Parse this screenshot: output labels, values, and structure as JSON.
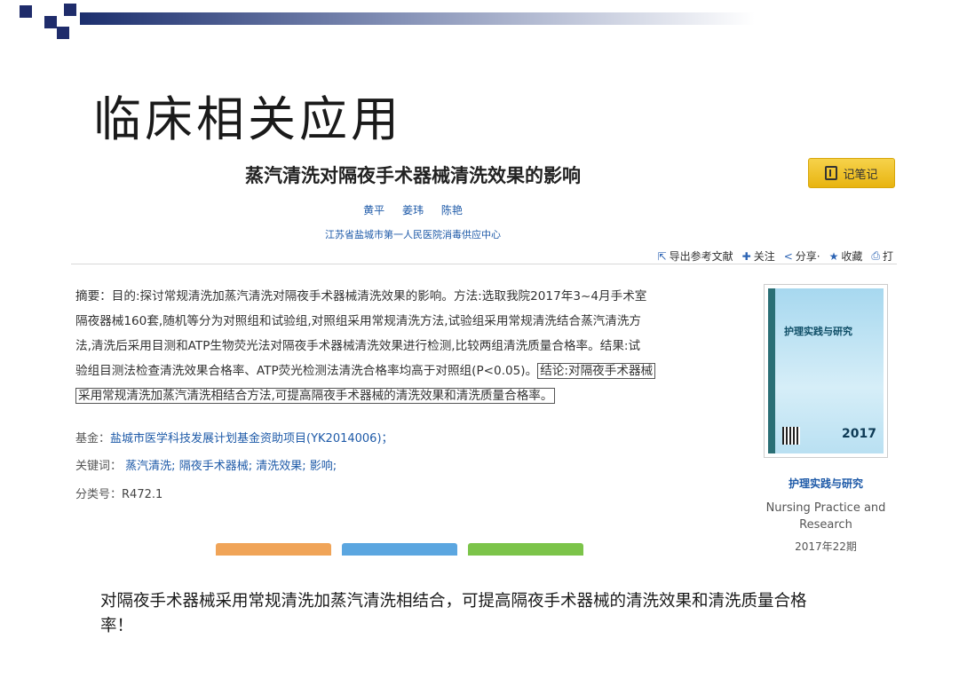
{
  "slide": {
    "title": "临床相关应用",
    "conclusion": "对隔夜手术器械采用常规清洗加蒸汽清洗相结合，可提高隔夜手术器械的清洗效果和清洗质量合格率！"
  },
  "article": {
    "title": "蒸汽清洗对隔夜手术器械清洗效果的影响",
    "note_button": "记笔记",
    "authors": [
      "黄平",
      "姜玮",
      "陈艳"
    ],
    "affiliation": "江苏省盐城市第一人民医院消毒供应中心",
    "tools": [
      {
        "icon": "export-icon",
        "label": "导出参考文献"
      },
      {
        "icon": "plus-icon",
        "label": "关注"
      },
      {
        "icon": "share-icon",
        "label": "分享·"
      },
      {
        "icon": "star-icon",
        "label": "收藏"
      },
      {
        "icon": "print-icon",
        "label": "打"
      }
    ],
    "abstract_lines": [
      "摘要：目的:探讨常规清洗加蒸汽清洗对隔夜手术器械清洗效果的影响。方法:选取我院2017年3~4月手术室",
      "隔夜器械160套,随机等分为对照组和试验组,对照组采用常规清洗方法,试验组采用常规清洗结合蒸汽清洗方",
      "法,清洗后采用目测和ATP生物荧光法对隔夜手术器械清洗效果进行检测,比较两组清洗质量合格率。结果:试",
      "验组目测法检查清洗效果合格率、ATP荧光检测法清洗合格率均高于对照组(P<0.05)。"
    ],
    "conclusion_part1": "结论:对隔夜手术器械",
    "conclusion_part2": "采用常规清洗加蒸汽清洗相结合方法,可提高隔夜手术器械的清洗效果和清洗质量合格率。",
    "fund_label": "基金：",
    "fund_value": "盐城市医学科技发展计划基金资助项目(YK2014006)；",
    "keywords_label": "关键词：",
    "keywords": [
      "蒸汽清洗;",
      "隔夜手术器械;",
      "清洗效果;",
      "影响;"
    ],
    "class_label": "分类号：",
    "class_value": "R472.1"
  },
  "journal": {
    "cover_title": "护理实践与研究",
    "cover_year": "2017",
    "name_cn": "护理实践与研究",
    "name_en": "Nursing Practice and Research",
    "issue": "2017年22期"
  },
  "colors": {
    "link": "#1e5aa8",
    "note_button": "#e8b410",
    "tab_orange": "#f0a458",
    "tab_blue": "#5ba6e0",
    "tab_green": "#7cc44a"
  }
}
